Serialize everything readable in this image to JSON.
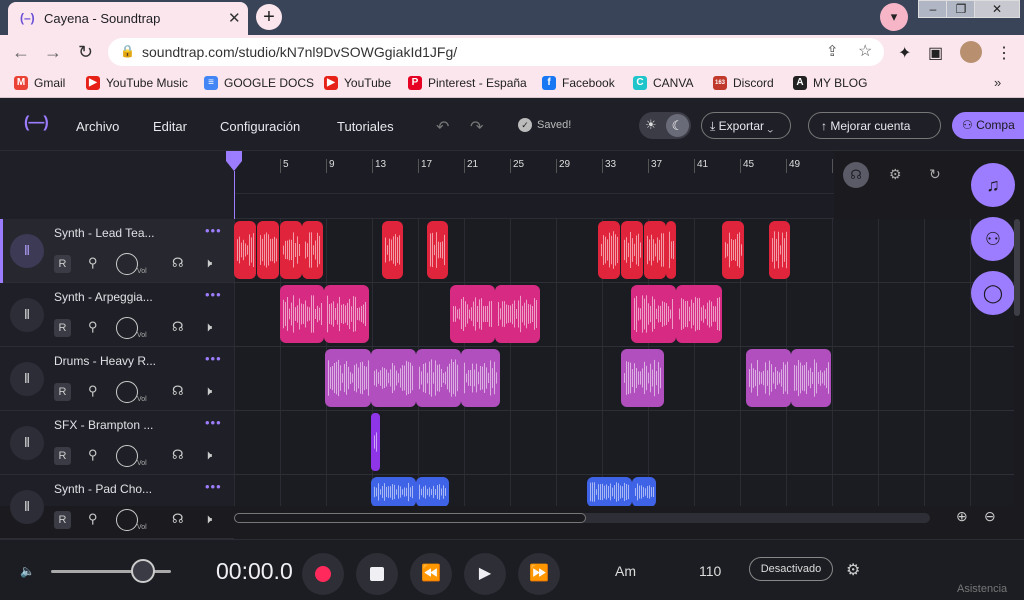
{
  "browser": {
    "tab_title": "Cayena - Soundtrap",
    "tab_favicon": "(–)",
    "new_tab": "+",
    "url": "soundtrap.com/studio/kN7nl9DvSOWGgiakId1JFg/",
    "bookmarks": [
      {
        "label": "Gmail",
        "icon": "gmail-icon",
        "color": "#ea4335",
        "glyph": "M"
      },
      {
        "label": "YouTube Music",
        "icon": "youtube-music-icon",
        "color": "#e62117",
        "glyph": "▶"
      },
      {
        "label": "GOOGLE DOCS",
        "icon": "google-docs-icon",
        "color": "#4285f4",
        "glyph": "≡"
      },
      {
        "label": "YouTube",
        "icon": "youtube-icon",
        "color": "#e62117",
        "glyph": "▶"
      },
      {
        "label": "Pinterest - España",
        "icon": "pinterest-icon",
        "color": "#e60023",
        "glyph": "P"
      },
      {
        "label": "Facebook",
        "icon": "facebook-icon",
        "color": "#1877f2",
        "glyph": "f"
      },
      {
        "label": "CANVA",
        "icon": "canva-icon",
        "color": "#20c4cb",
        "glyph": "C"
      },
      {
        "label": "Discord",
        "icon": "discord-icon",
        "color": "#c0392b",
        "glyph": "163"
      },
      {
        "label": "MY BLOG",
        "icon": "blog-icon",
        "color": "#222222",
        "glyph": "A"
      }
    ],
    "bookmarks_more": "»"
  },
  "app": {
    "logo": "(—)",
    "menu": [
      "Archivo",
      "Editar",
      "Configuración",
      "Tutoriales"
    ],
    "saved": "Saved!",
    "export": "Exportar",
    "upgrade": "Mejorar cuenta",
    "collab": "Compa",
    "accent": "#9d7dff"
  },
  "ruler": {
    "ticks": [
      "5",
      "9",
      "13",
      "17",
      "21",
      "25",
      "29",
      "33",
      "37",
      "41",
      "45",
      "49",
      "5"
    ]
  },
  "tracks": [
    {
      "name": "Synth - Lead Tea...",
      "r": "R",
      "vol": "Vol",
      "color": "#e0243c",
      "clips": [
        [
          0,
          22
        ],
        [
          23,
          22
        ],
        [
          46,
          22
        ],
        [
          68,
          21
        ],
        [
          148,
          21
        ],
        [
          193,
          21
        ],
        [
          364,
          22
        ],
        [
          387,
          22
        ],
        [
          410,
          22
        ],
        [
          432,
          10
        ],
        [
          488,
          22
        ],
        [
          535,
          21
        ]
      ]
    },
    {
      "name": "Synth - Arpeggia...",
      "r": "R",
      "vol": "Vol",
      "color": "#d62a83",
      "clips": [
        [
          46,
          44
        ],
        [
          90,
          45
        ],
        [
          216,
          45
        ],
        [
          261,
          45
        ],
        [
          397,
          45
        ],
        [
          442,
          46
        ]
      ]
    },
    {
      "name": "Drums - Heavy R...",
      "r": "R",
      "vol": "Vol",
      "color": "#b04fbd",
      "clips": [
        [
          91,
          46
        ],
        [
          137,
          45
        ],
        [
          182,
          45
        ],
        [
          227,
          39
        ],
        [
          387,
          43
        ],
        [
          512,
          45
        ],
        [
          557,
          40
        ]
      ]
    },
    {
      "name": "SFX - Brampton ...",
      "r": "R",
      "vol": "Vol",
      "color": "#8f35e8",
      "clips": [
        [
          137,
          9
        ]
      ]
    },
    {
      "name": "Synth - Pad Cho...",
      "r": "R",
      "vol": "Vol",
      "color": "#3f63e6",
      "clips": [
        [
          137,
          45
        ],
        [
          182,
          33
        ],
        [
          353,
          45
        ],
        [
          398,
          24
        ]
      ]
    }
  ],
  "transport": {
    "time": "00:00.0",
    "key": "Am",
    "tempo": "110",
    "metronome": "Desactivado",
    "assist": "Asistencia"
  }
}
